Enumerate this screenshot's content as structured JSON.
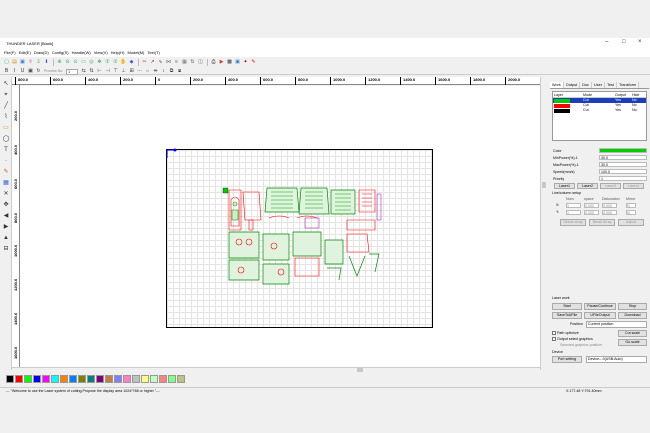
{
  "window": {
    "title": "THUNDER LASER [Blank]",
    "minimize_glyph": "–",
    "maximize_glyph": "□",
    "close_glyph": "×"
  },
  "menu": [
    "File(F)",
    "Edit(E)",
    "Draw(D)",
    "Config(S)",
    "Handle(W)",
    "View(V)",
    "Help(H)",
    "Model(M)",
    "Text(T)"
  ],
  "toolbar": {
    "row1_icons": [
      "new-icon",
      "open-icon",
      "save-icon",
      "import-icon",
      "export-icon",
      "download-icon",
      "zoom-in-icon",
      "zoom-out-icon",
      "zoom-fit-icon",
      "zoom-page-icon",
      "zoom-select-icon",
      "zoom-move-icon",
      "zoom-1-icon",
      "zoom-2-icon",
      "pan-icon",
      "node-icon",
      "cut-icon",
      "arrow-icon",
      "curve-icon",
      "weld-icon",
      "align-icon",
      "array-icon",
      "order-icon",
      "offset-icon",
      "print-icon",
      "simulate-icon",
      "frame-icon",
      "monitor-icon",
      "laser-icon",
      "pen-icon"
    ],
    "row2_icons": [
      "bold-icon",
      "italic-icon",
      "underline-icon",
      "box-icon",
      "rotate-icon",
      "mirror-h-icon",
      "mirror-v-icon",
      "align-left-icon",
      "align-right-icon",
      "align-top-icon",
      "align-bottom-icon",
      "align-center-icon",
      "distribute-icon",
      "size-icon",
      "same-width-icon",
      "same-height-icon",
      "group-icon",
      "ungroup-icon"
    ],
    "speed_label": "Process No:",
    "dropdown_value": "1"
  },
  "ruler": {
    "h_labels": [
      "800.0",
      "600.0",
      "400.0",
      "200.0",
      "0",
      "200.0",
      "400.0",
      "600.0",
      "800.0",
      "1000.0",
      "1200.0",
      "1400.0",
      "1600.0",
      "1800.0",
      "2000.0"
    ],
    "v_labels": [
      "200.0",
      "400.0",
      "600.0",
      "800.0",
      "1000.0",
      "1200.0",
      "1400.0",
      "1600.0"
    ]
  },
  "palette": [
    "#000000",
    "#ff0000",
    "#00ff00",
    "#0000ff",
    "#ff00ff",
    "#00ffff",
    "#ff8000",
    "#0080ff",
    "#808000",
    "#008080",
    "#800080",
    "#c08040",
    "#8080ff",
    "#ff80c0",
    "#c0c0c0",
    "#ffff80",
    "#c0ffc0",
    "#ff8080",
    "#80ff80",
    "#c0c080"
  ],
  "right_panel": {
    "tabs": [
      "Work",
      "Output",
      "Doc",
      "User",
      "Test",
      "Transform"
    ],
    "layer_headers": {
      "layer": "Layer",
      "mode": "Mode",
      "output": "Output",
      "hide": "Hide"
    },
    "layers": [
      {
        "color": "#00cc00",
        "mode": "Cut",
        "output": "Yes",
        "hide": "No"
      },
      {
        "color": "#ff0000",
        "mode": "Cut",
        "output": "Yes",
        "hide": "No"
      },
      {
        "color": "#000000",
        "mode": "Cut",
        "output": "Yes",
        "hide": "No"
      }
    ],
    "props": [
      {
        "label": "Color",
        "value": ""
      },
      {
        "label": "MinPower(%)-1",
        "value": "30.0"
      },
      {
        "label": "MaxPower(%)-1",
        "value": "30.0"
      },
      {
        "label": "Speed(mm/s)",
        "value": "100.0"
      },
      {
        "label": "Priority",
        "value": "1"
      }
    ],
    "laser_tabs": [
      "Laser1",
      "Laser2",
      "Laser3",
      "Laser4"
    ],
    "rotary_label": "Line/column setup",
    "rotary_headers": [
      "Num",
      "space",
      "Dislocation",
      "Mirror"
    ],
    "rotary_rows": [
      {
        "axis": "X:",
        "num": "1",
        "space": "0.000",
        "disl": "0.000",
        "mirror": "N"
      },
      {
        "axis": "Y:",
        "num": "1",
        "space": "0.000",
        "disl": "0.000",
        "mirror": "N"
      }
    ],
    "rotary_buttons": [
      "Virtual array",
      "Break Array",
      "Adjust"
    ],
    "laser_work_label": "Laser work",
    "buttons": {
      "start": "Start",
      "pause": "Pause/Continue",
      "stop": "Stop",
      "save_to_file": "SaveToUFile",
      "ufile_output": "UFileOutput",
      "download": "Download",
      "cut_scale": "Cut scale",
      "go_scale": "Go scale",
      "port_setting": "Port setting"
    },
    "position_label": "Position",
    "position_value": "Current position",
    "path_optimize": "Path optimize",
    "output_select": "Output select graphics",
    "selected_graphics": "Selected graphics position",
    "device_label": "Device",
    "device_value": "Device---0(USB:Auto)"
  },
  "status": {
    "message": "--- \"Welcome to use the Laser system of cutting,Propose the display area 1024*768 or higher \"---",
    "coords": "X:177.48 Y:791.40mm"
  }
}
